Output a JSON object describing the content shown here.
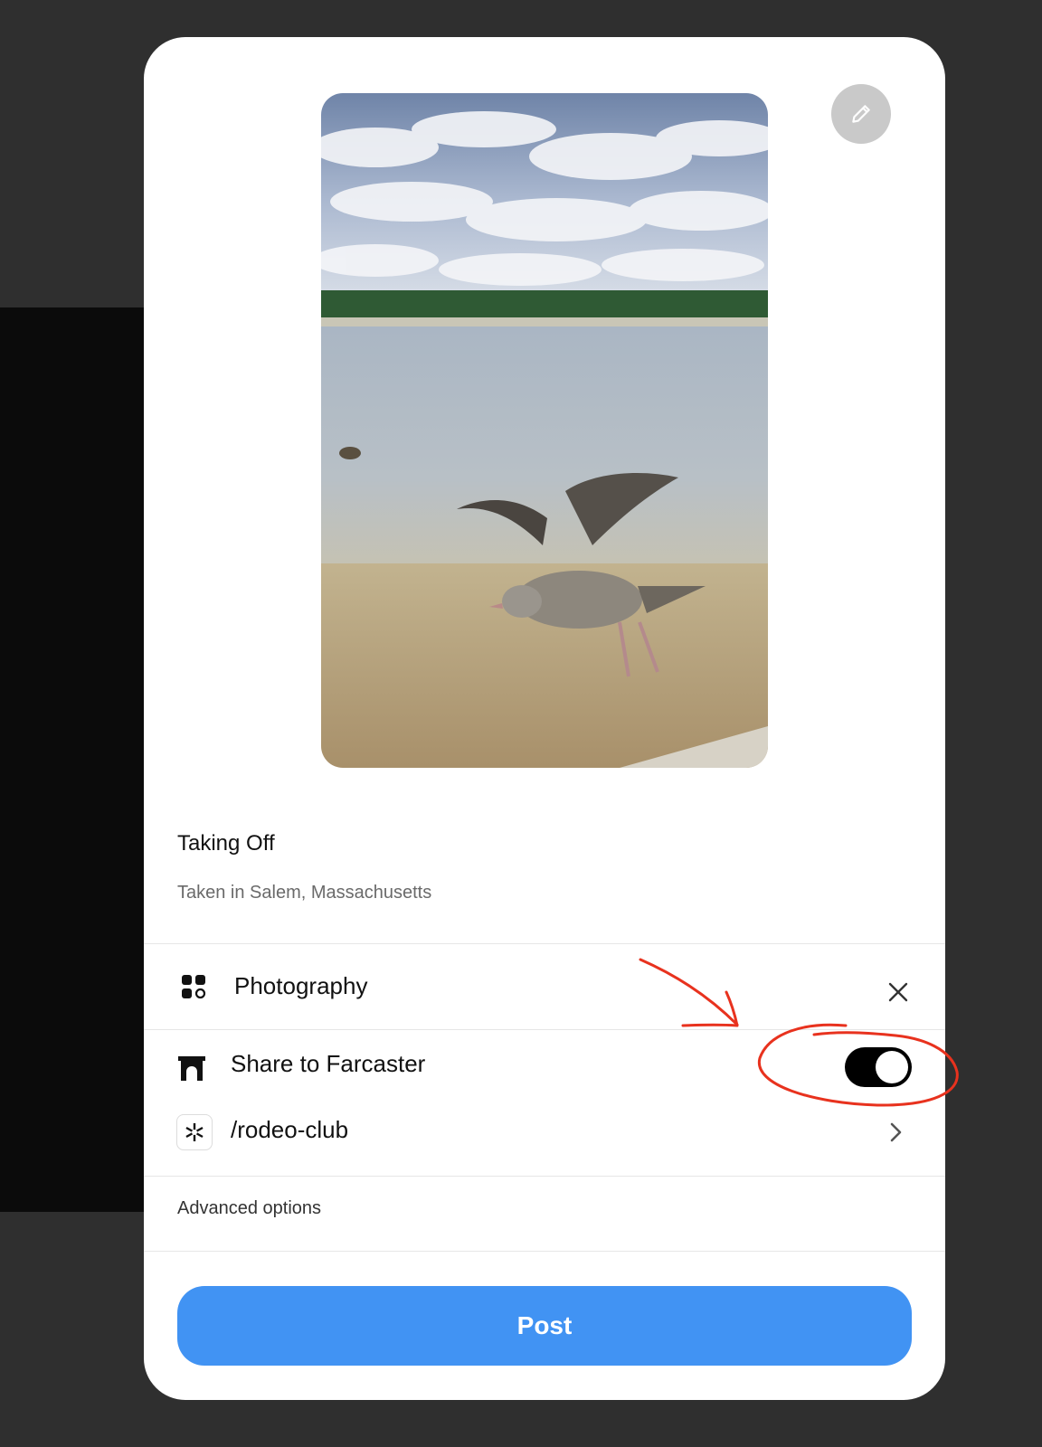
{
  "post": {
    "title": "Taking Off",
    "description": "Taken in Salem, Massachusetts"
  },
  "collection": {
    "label": "Photography",
    "icon": "apps-icon",
    "remove_icon": "close-icon"
  },
  "share": {
    "label": "Share to Farcaster",
    "icon": "farcaster-arch-icon",
    "enabled": true
  },
  "channel": {
    "label": "/rodeo-club",
    "icon": "asterisk-icon"
  },
  "advanced_options_label": "Advanced options",
  "post_button_label": "Post",
  "colors": {
    "accent": "#4193f3",
    "toggle_on": "#000000",
    "annotation": "#e8321e"
  }
}
